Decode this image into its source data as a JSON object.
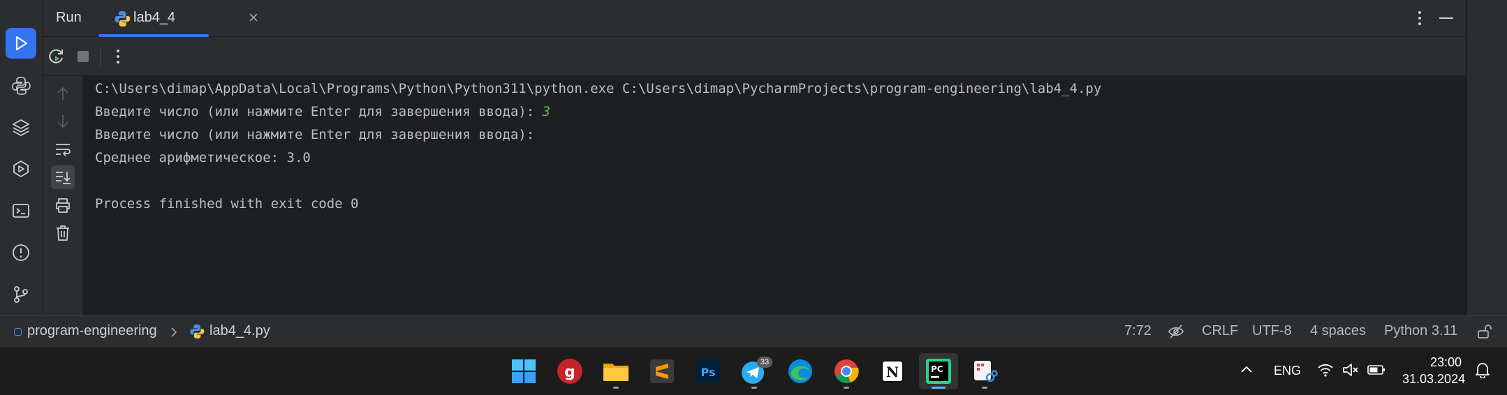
{
  "run_panel": {
    "title": "Run",
    "tab": {
      "label": "lab4_4"
    }
  },
  "console": {
    "lines": [
      {
        "text": "C:\\Users\\dimap\\AppData\\Local\\Programs\\Python\\Python311\\python.exe C:\\Users\\dimap\\PycharmProjects\\program-engineering\\lab4_4.py",
        "input": ""
      },
      {
        "text": "Введите число (или нажмите Enter для завершения ввода): ",
        "input": "3"
      },
      {
        "text": "Введите число (или нажмите Enter для завершения ввода):",
        "input": ""
      },
      {
        "text": "Среднее арифметическое: 3.0",
        "input": ""
      },
      {
        "text": "",
        "input": ""
      },
      {
        "text": "Process finished with exit code 0",
        "input": ""
      }
    ]
  },
  "status_bar": {
    "breadcrumb": {
      "project": "program-engineering",
      "file": "lab4_4.py"
    },
    "position": "7:72",
    "line_ending": "CRLF",
    "encoding": "UTF-8",
    "indent": "4 spaces",
    "interpreter": "Python 3.11"
  },
  "taskbar": {
    "apps": [
      {
        "name": "start",
        "icon": "windows-start-icon"
      },
      {
        "name": "vivaldi",
        "icon": "vivaldi-icon"
      },
      {
        "name": "explorer",
        "icon": "file-explorer-icon"
      },
      {
        "name": "sublime",
        "icon": "sublime-text-icon"
      },
      {
        "name": "photoshop",
        "icon": "photoshop-icon",
        "label": "Ps"
      },
      {
        "name": "telegram",
        "icon": "telegram-icon",
        "badge": "33"
      },
      {
        "name": "edge",
        "icon": "edge-icon"
      },
      {
        "name": "chrome",
        "icon": "chrome-icon"
      },
      {
        "name": "notion",
        "icon": "notion-icon",
        "label": "N"
      },
      {
        "name": "pycharm",
        "icon": "pycharm-icon",
        "label": "PC"
      },
      {
        "name": "snipping",
        "icon": "snipping-tool-icon"
      }
    ],
    "tray": {
      "language": "ENG",
      "time": "23:00",
      "date": "31.03.2024"
    }
  },
  "colors": {
    "accent": "#3574f0",
    "panel": "#2b2d30",
    "editor_bg": "#1e1f22",
    "user_input": "#5fb865"
  }
}
